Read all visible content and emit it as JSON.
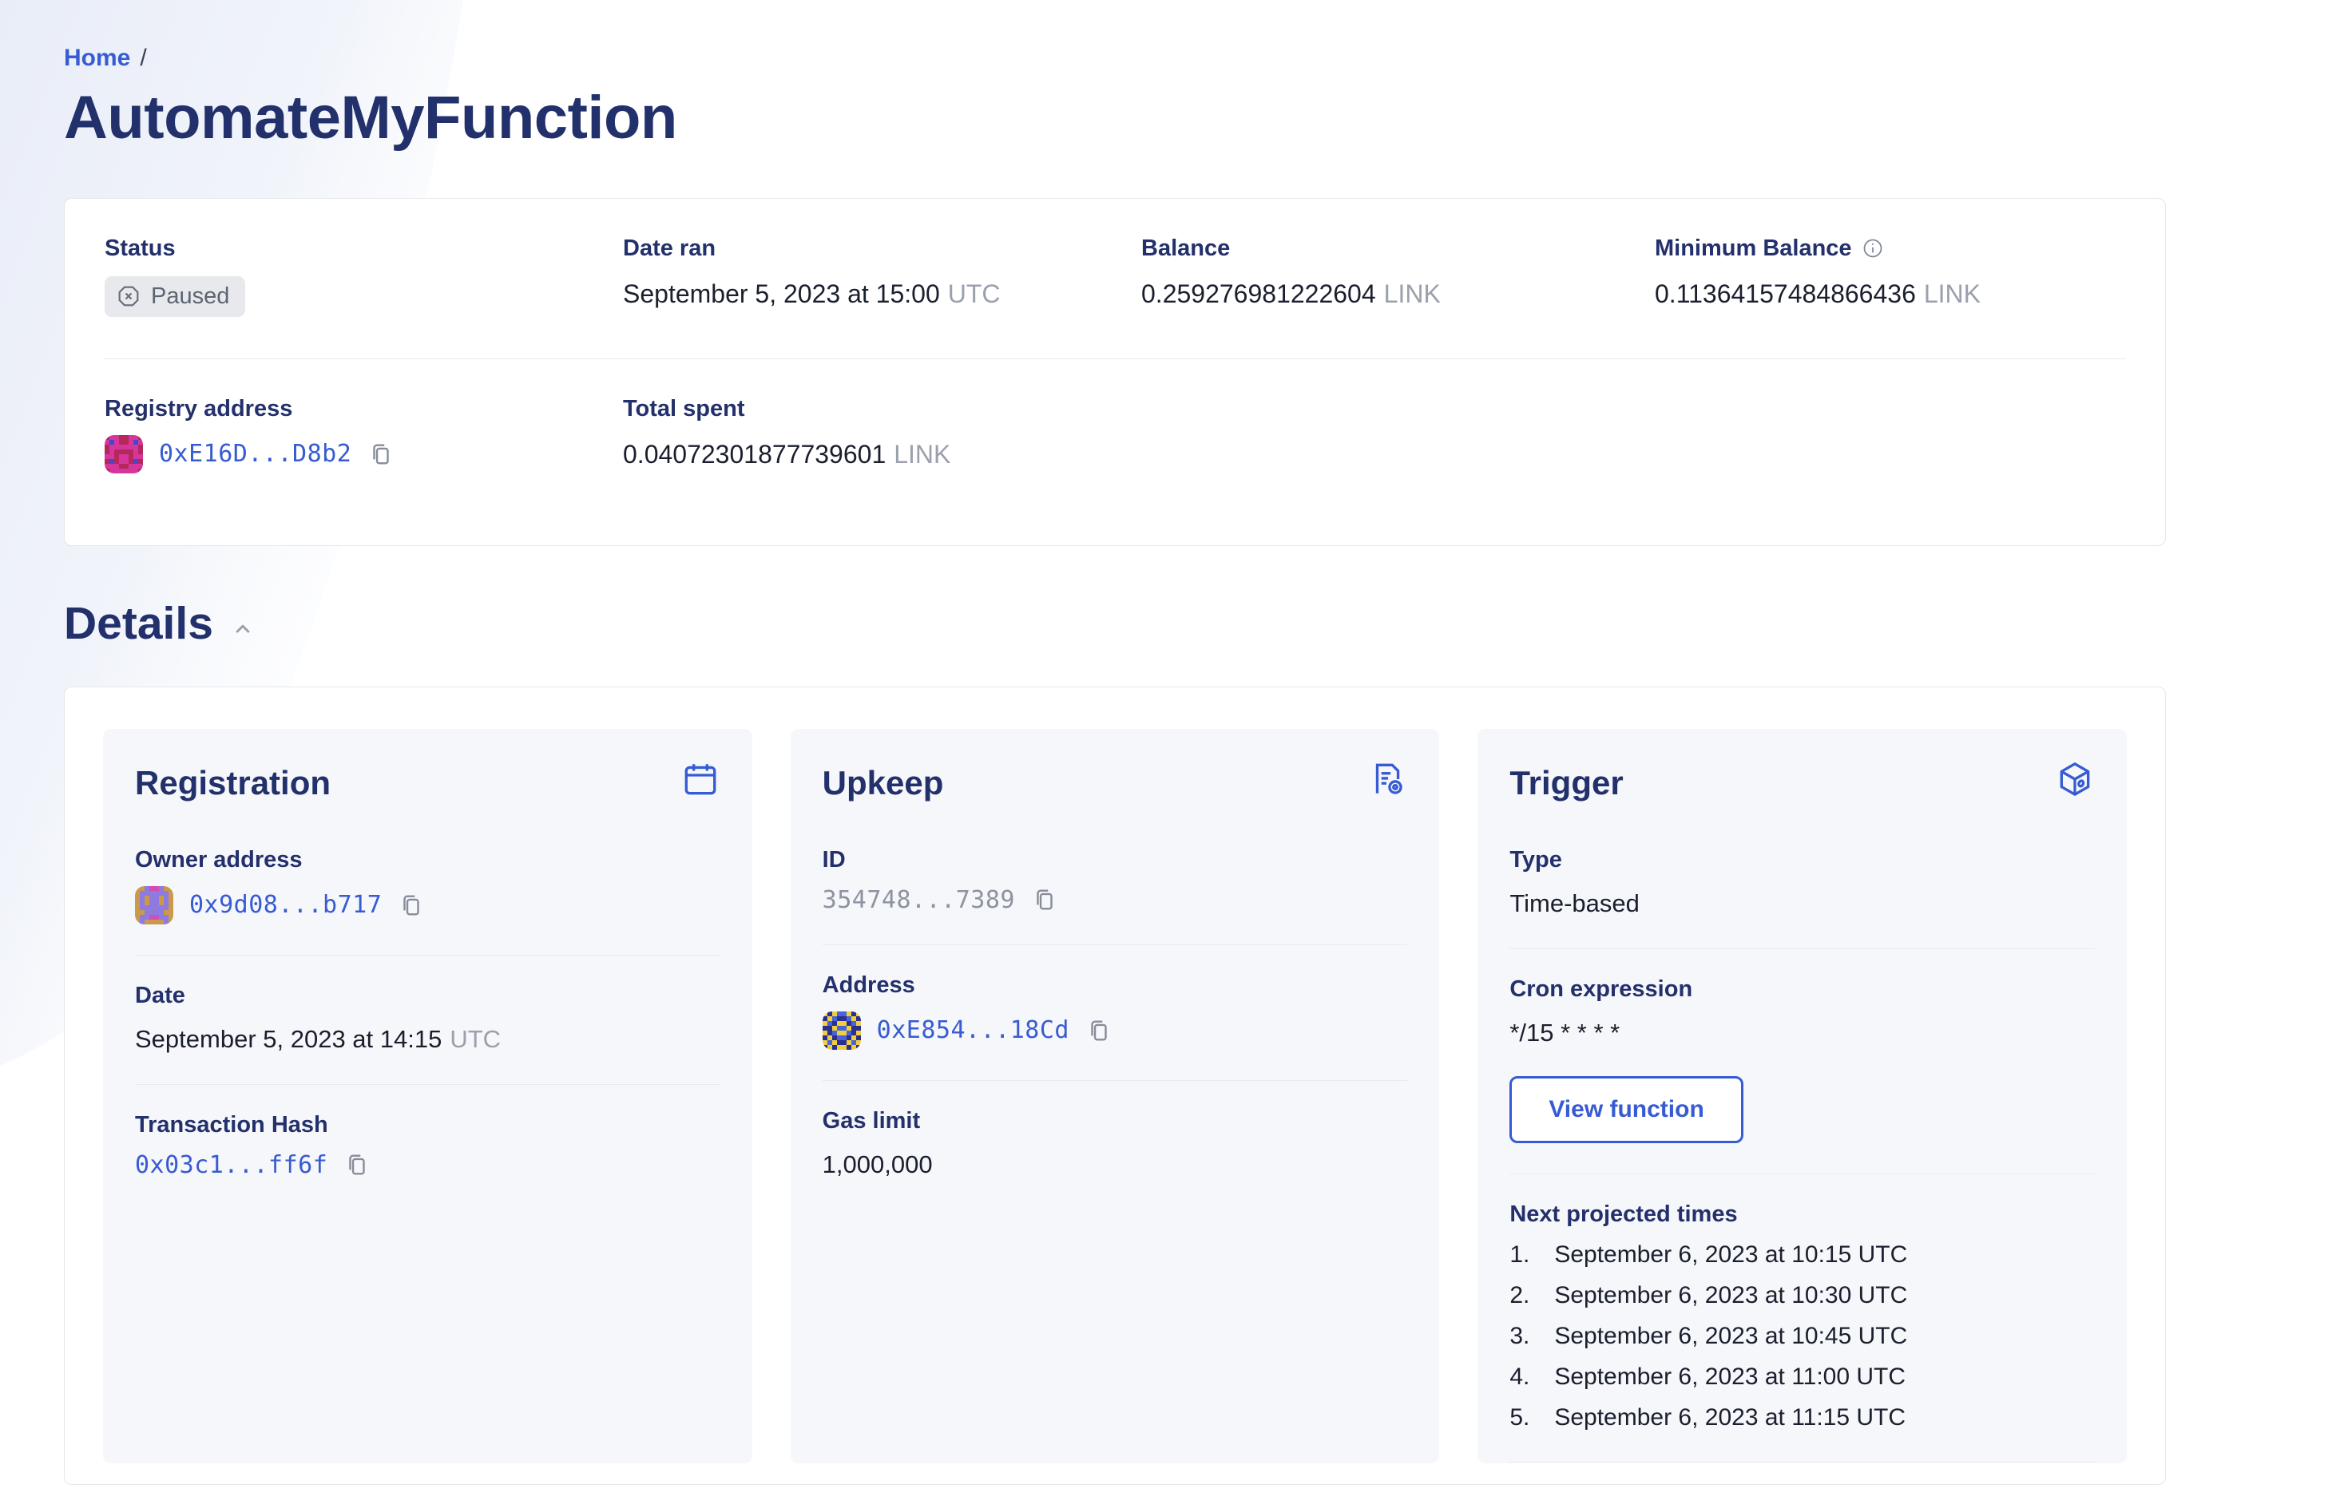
{
  "colors": {
    "accent_blue": "#375bd2",
    "heading_navy": "#22306b",
    "text_dark": "#1a1f2e",
    "muted_grey": "#9aa0ad",
    "badge_bg": "#e8e9ec",
    "card_bg": "#f6f7fa"
  },
  "breadcrumb": {
    "home": "Home",
    "separator": "/"
  },
  "page": {
    "title": "AutomateMyFunction"
  },
  "summary": {
    "status": {
      "label": "Status",
      "badge": "Paused"
    },
    "date_ran": {
      "label": "Date ran",
      "value": "September 5, 2023 at 15:00",
      "suffix": "UTC"
    },
    "balance": {
      "label": "Balance",
      "value": "0.259276981222604",
      "suffix": "LINK"
    },
    "min_balance": {
      "label": "Minimum Balance",
      "value": "0.11364157484866436",
      "suffix": "LINK"
    },
    "registry": {
      "label": "Registry address",
      "address": "0xE16D...D8b2"
    },
    "total_spent": {
      "label": "Total spent",
      "value": "0.04072301877739601",
      "suffix": "LINK"
    }
  },
  "details": {
    "heading": "Details"
  },
  "registration": {
    "title": "Registration",
    "owner_label": "Owner address",
    "owner_address": "0x9d08...b717",
    "date_label": "Date",
    "date_value": "September 5, 2023 at 14:15",
    "date_suffix": "UTC",
    "tx_label": "Transaction Hash",
    "tx_hash": "0x03c1...ff6f"
  },
  "upkeep": {
    "title": "Upkeep",
    "id_label": "ID",
    "id_value": "354748...7389",
    "address_label": "Address",
    "address": "0xE854...18Cd",
    "gas_label": "Gas limit",
    "gas_value": "1,000,000"
  },
  "trigger": {
    "title": "Trigger",
    "type_label": "Type",
    "type_value": "Time-based",
    "cron_label": "Cron expression",
    "cron_value": "*/15 * * * *",
    "view_function_label": "View function",
    "next_label": "Next projected times",
    "next_times": [
      {
        "n": "1.",
        "t": "September 6, 2023 at 10:15 UTC"
      },
      {
        "n": "2.",
        "t": "September 6, 2023 at 10:30 UTC"
      },
      {
        "n": "3.",
        "t": "September 6, 2023 at 10:45 UTC"
      },
      {
        "n": "4.",
        "t": "September 6, 2023 at 11:00 UTC"
      },
      {
        "n": "5.",
        "t": "September 6, 2023 at 11:15 UTC"
      }
    ]
  },
  "identicons": {
    "registry": {
      "palette": [
        "#d6359c",
        "#b5285b",
        "#4149d0"
      ],
      "pattern": [
        "10011001",
        "02011020",
        "10000001",
        "10111101",
        "00100100",
        "12100121",
        "00011000",
        "10000001"
      ]
    },
    "owner": {
      "palette": [
        "#c99a4d",
        "#8f7ae0",
        "#cf4fb4"
      ],
      "pattern": [
        "00122100",
        "01111110",
        "01011010",
        "01011010",
        "01111110",
        "00111100",
        "01122110",
        "01000010"
      ]
    },
    "upkeep_address": {
      "palette": [
        "#2b2f8f",
        "#efcf3d",
        "#4a63d8"
      ],
      "pattern": [
        "10122101",
        "01200210",
        "12011021",
        "00122100",
        "10211201",
        "01022010",
        "12100121",
        "01011010"
      ]
    }
  }
}
